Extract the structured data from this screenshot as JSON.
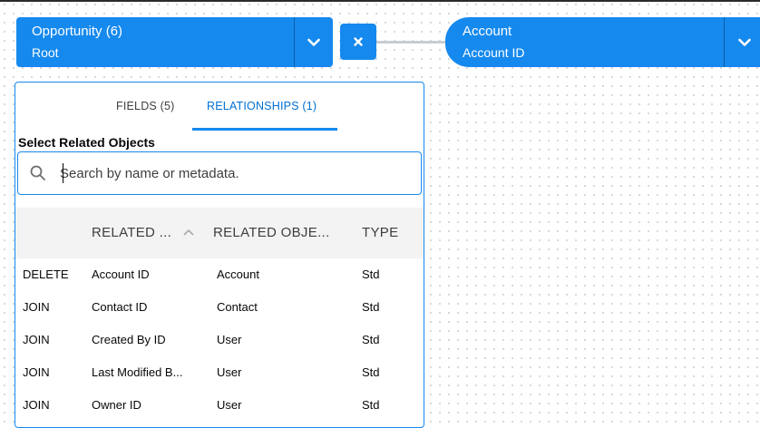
{
  "root_node": {
    "title": "Opportunity (6)",
    "subtitle": "Root"
  },
  "account_node": {
    "title": "Account",
    "subtitle": "Account ID"
  },
  "tabs": [
    {
      "label": "FIELDS (5)",
      "active": false
    },
    {
      "label": "RELATIONSHIPS (1)",
      "active": true
    }
  ],
  "section_title": "Select Related Objects",
  "search": {
    "placeholder": "Search by name or metadata."
  },
  "table": {
    "columns": [
      "RELATED ...",
      "RELATED OBJE...",
      "TYPE"
    ],
    "rows": [
      {
        "action": "DELETE",
        "field": "Account ID",
        "object": "Account",
        "type": "Std"
      },
      {
        "action": "JOIN",
        "field": "Contact ID",
        "object": "Contact",
        "type": "Std"
      },
      {
        "action": "JOIN",
        "field": "Created By ID",
        "object": "User",
        "type": "Std"
      },
      {
        "action": "JOIN",
        "field": "Last Modified B...",
        "object": "User",
        "type": "Std"
      },
      {
        "action": "JOIN",
        "field": "Owner ID",
        "object": "User",
        "type": "Std"
      }
    ]
  },
  "colors": {
    "brand": "#1589ee",
    "active_tab": "#0070d2",
    "header_bg": "#f3f3f3"
  }
}
